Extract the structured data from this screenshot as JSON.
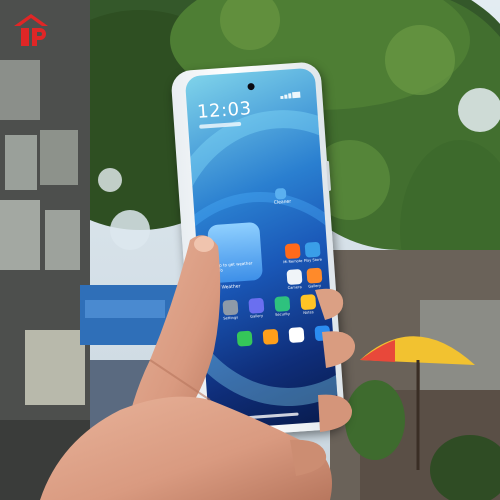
{
  "scene": {
    "description_icons": [
      "store-logo-icon"
    ],
    "colors": {
      "foliage": "#3f6b2c",
      "sky": "#dbe6ee",
      "umbrella": "#f2c230",
      "logo": "#e02626"
    }
  },
  "phone": {
    "clock": "12:03",
    "weather_widget": {
      "text": "Tap to get weather info",
      "label": "Weather"
    },
    "apps": [
      {
        "label": "Mi Remote",
        "color": "#ff6a1a",
        "icon": "mi-icon"
      },
      {
        "label": "Play Store",
        "color": "#3a9ee8",
        "icon": "play-store-icon"
      },
      {
        "label": "Camera",
        "color": "#f0f4f8",
        "icon": "camera-icon"
      },
      {
        "label": "Gallery",
        "color": "#ff8a2a",
        "icon": "gallery-icon"
      },
      {
        "label": "Settings",
        "color": "#8e9aa8",
        "icon": "settings-icon"
      },
      {
        "label": "Gallery",
        "color": "#6a6ff0",
        "icon": "photos-icon"
      },
      {
        "label": "Security",
        "color": "#2ec27e",
        "icon": "security-icon"
      },
      {
        "label": "Notes",
        "color": "#ffc425",
        "icon": "notes-icon"
      },
      {
        "label": "",
        "color": "#35c759",
        "icon": "phone-icon"
      },
      {
        "label": "",
        "color": "#ff9f1a",
        "icon": "messages-icon"
      },
      {
        "label": "",
        "color": "#ffffff",
        "icon": "browser-icon"
      },
      {
        "label": "",
        "color": "#2b8cf0",
        "icon": "app-icon"
      }
    ],
    "dock_label": "Cleaner"
  }
}
